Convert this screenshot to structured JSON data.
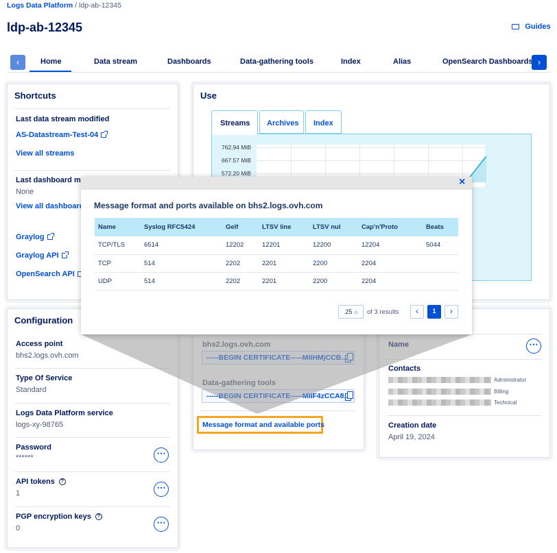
{
  "header": {
    "breadcrumb_root": "Logs Data Platform",
    "breadcrumb_sep": "/",
    "breadcrumb_current": "ldp-ab-12345",
    "page_title": "ldp-ab-12345",
    "guides_label": "Guides"
  },
  "tabs": [
    "Home",
    "Data stream",
    "Dashboards",
    "Data-gathering tools",
    "Index",
    "Alias",
    "OpenSearch Dashboards"
  ],
  "shortcuts": {
    "title": "Shortcuts",
    "last_stream_label": "Last data stream modified",
    "last_stream_link": "AS-Datastream-Test-04",
    "view_all_streams": "View all streams",
    "last_dashboard_label": "Last dashboard mod",
    "last_dashboard_value": "None",
    "view_all_dashboards": "View all dashboards",
    "graylog": "Graylog",
    "graylog_api": "Graylog API",
    "opensearch_api": "OpenSearch API"
  },
  "use": {
    "title": "Use",
    "tabs": [
      "Streams",
      "Archives",
      "Index"
    ],
    "y_ticks": [
      "762.94 MiB",
      "667.57 MiB",
      "572.20 MiB"
    ]
  },
  "modal": {
    "close": "×",
    "title": "Message format and ports available on bhs2.logs.ovh.com",
    "columns": [
      "Name",
      "Syslog RFC5424",
      "Gelf",
      "LTSV line",
      "LTSV nul",
      "Cap'n'Proto",
      "Beats"
    ],
    "rows": [
      [
        "TCP/TLS",
        "6514",
        "12202",
        "12201",
        "12200",
        "12204",
        "5044"
      ],
      [
        "TCP",
        "514",
        "2202",
        "2201",
        "2200",
        "2204",
        ""
      ],
      [
        "UDP",
        "514",
        "2202",
        "2201",
        "2200",
        "2204",
        ""
      ]
    ],
    "page_size": "25",
    "results": "of 3 results",
    "current_page": "1"
  },
  "configuration": {
    "title": "Configuration",
    "access_point_label": "Access point",
    "access_point_value": "bhs2.logs.ovh.com",
    "service_type_label": "Type Of Service",
    "service_type_value": "Standard",
    "ldp_service_label": "Logs Data Platform service",
    "ldp_service_value": "logs-xy-98765",
    "password_label": "Password",
    "password_value": "******",
    "api_tokens_label": "API tokens",
    "api_tokens_value": "1",
    "pgp_label": "PGP encryption keys",
    "pgp_value": "0"
  },
  "certificates": {
    "host_label": "bhs2.logs.ovh.com",
    "host_cert": "-----BEGIN CERTIFICATE-----MIIHMjCCB...",
    "tools_label": "Data-gathering tools",
    "tools_cert": "-----BEGIN CERTIFICATE-----MIIF4zCCA8...",
    "ports_link": "Message format and available ports"
  },
  "info": {
    "name_label": "Name",
    "contacts_label": "Contacts",
    "contact_roles": [
      "Administrator",
      "Billing",
      "Technical"
    ],
    "creation_label": "Creation date",
    "creation_value": "April 19, 2024"
  },
  "colors": {
    "accent": "#0050d7",
    "highlight": "#f5a623",
    "table_header": "#bbe9fa",
    "chart_fill": "#dff5fc"
  }
}
